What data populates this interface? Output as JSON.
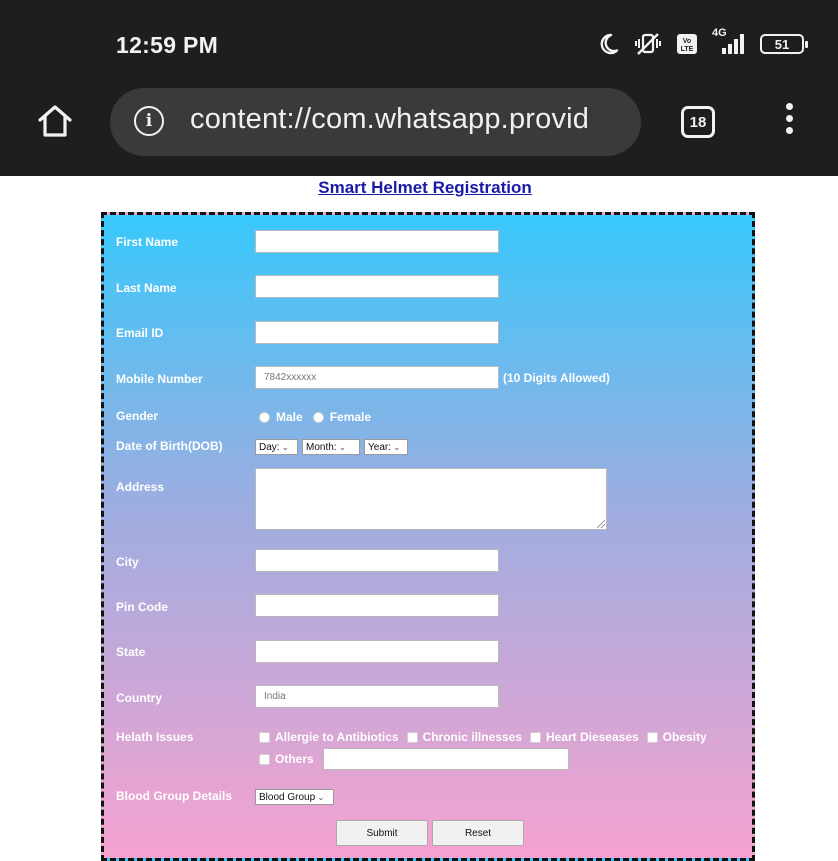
{
  "status_bar": {
    "time": "12:59 PM",
    "network_label": "4G",
    "battery": "51"
  },
  "browser": {
    "url": "content://com.whatsapp.provid",
    "tab_count": "18"
  },
  "page": {
    "title": "Smart Helmet Registration"
  },
  "form": {
    "labels": {
      "first_name": "First Name",
      "last_name": "Last Name",
      "email": "Email ID",
      "mobile": "Mobile Number",
      "gender": "Gender",
      "dob": "Date of Birth(DOB)",
      "address": "Address",
      "city": "City",
      "pin": "Pin Code",
      "state": "State",
      "country": "Country",
      "health": "Helath Issues",
      "blood": "Blood Group Details"
    },
    "values": {
      "first_name": "",
      "last_name": "",
      "email": "",
      "mobile": "7842xxxxxx",
      "address": "",
      "city": "",
      "pin": "",
      "state": "",
      "country": "India",
      "others": ""
    },
    "mobile_hint": "(10 Digits Allowed)",
    "gender_options": [
      "Male",
      "Female"
    ],
    "dob_selects": {
      "day": "Day:",
      "month": "Month:",
      "year": "Year:"
    },
    "health_options": [
      "Allergie to Antibiotics",
      "Chronic illnesses",
      "Heart Dieseases",
      "Obesity",
      "Others"
    ],
    "blood_select": "Blood Group",
    "buttons": {
      "submit": "Submit",
      "reset": "Reset"
    }
  }
}
